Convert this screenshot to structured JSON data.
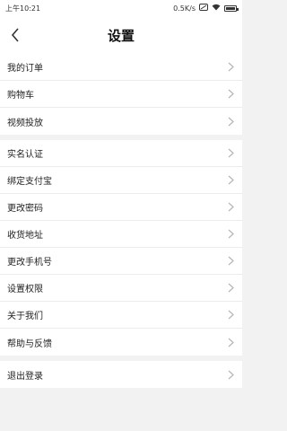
{
  "status_bar": {
    "time": "上午10:21",
    "net_speed": "0.5K/s"
  },
  "header": {
    "title": "设置"
  },
  "groups": [
    {
      "items": [
        "我的订单",
        "购物车",
        "视频投放"
      ]
    },
    {
      "items": [
        "实名认证",
        "绑定支付宝",
        "更改密码",
        "收货地址",
        "更改手机号",
        "设置权限",
        "关于我们",
        "帮助与反馈"
      ]
    },
    {
      "items": [
        "退出登录"
      ]
    }
  ]
}
